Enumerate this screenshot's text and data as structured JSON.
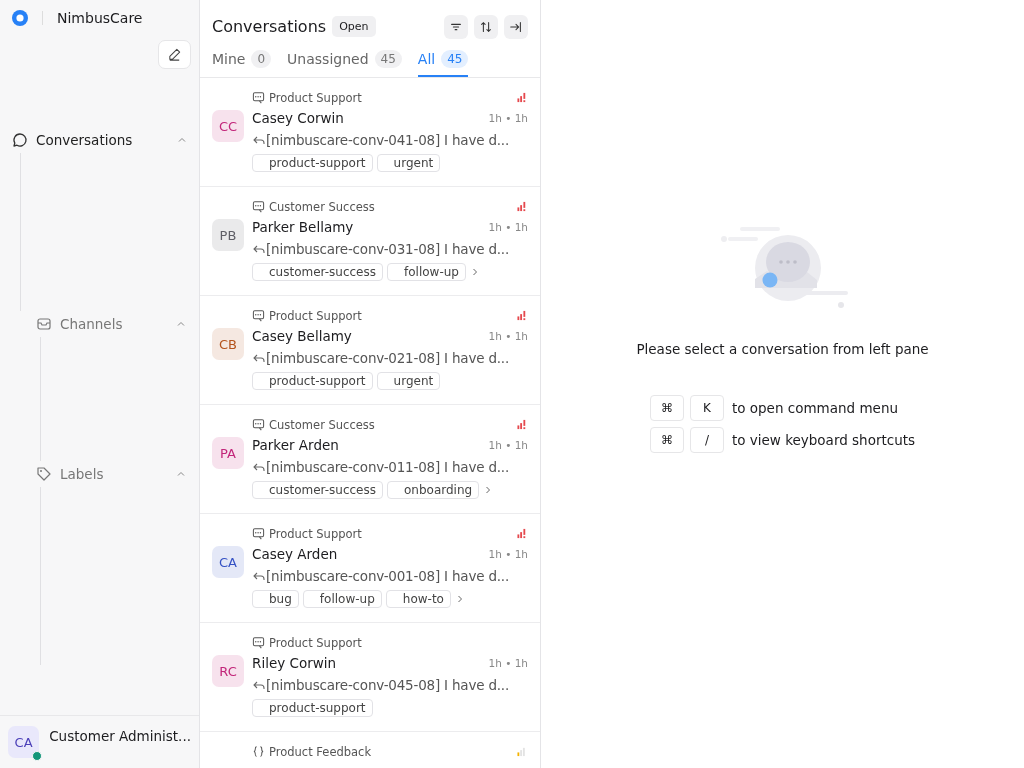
{
  "sidebar": {
    "brand": "NimbusCare",
    "sections": [
      {
        "label": "Conversations",
        "expanded": true,
        "kind": "top"
      },
      {
        "label": "Channels",
        "expanded": true,
        "kind": "nested"
      },
      {
        "label": "Labels",
        "expanded": true,
        "kind": "nested"
      }
    ],
    "user": {
      "initials": "CA",
      "name": "Customer Administ...",
      "online": true
    }
  },
  "list": {
    "title": "Conversations",
    "status": "Open",
    "tabs": [
      {
        "label": "Mine",
        "count": "0",
        "selected": false
      },
      {
        "label": "Unassigned",
        "count": "45",
        "selected": false
      },
      {
        "label": "All",
        "count": "45",
        "selected": true
      }
    ],
    "conversations": [
      {
        "inbox": {
          "name": "Product Support",
          "kind": "web"
        },
        "priority": {
          "kind": "urgent"
        },
        "initials": "CC",
        "color": "#c2267a",
        "name": "Casey Corwin",
        "time": "1h • 1h",
        "preview": "[nimbuscare-conv-041-08] I have d...",
        "tags": [
          "product-support",
          "urgent"
        ],
        "more_tags": false
      },
      {
        "inbox": {
          "name": "Customer Success",
          "kind": "web"
        },
        "priority": {
          "kind": "urgent"
        },
        "initials": "PB",
        "color": "#5f5f66",
        "name": "Parker Bellamy",
        "time": "1h • 1h",
        "preview": "[nimbuscare-conv-031-08] I have d...",
        "tags": [
          "customer-success",
          "follow-up"
        ],
        "more_tags": true
      },
      {
        "inbox": {
          "name": "Product Support",
          "kind": "web"
        },
        "priority": {
          "kind": "urgent"
        },
        "initials": "CB",
        "color": "#b4531c",
        "name": "Casey Bellamy",
        "time": "1h • 1h",
        "preview": "[nimbuscare-conv-021-08] I have d...",
        "tags": [
          "product-support",
          "urgent"
        ],
        "more_tags": false
      },
      {
        "inbox": {
          "name": "Customer Success",
          "kind": "web"
        },
        "priority": {
          "kind": "urgent"
        },
        "initials": "PA",
        "color": "#c2267a",
        "name": "Parker Arden",
        "time": "1h • 1h",
        "preview": "[nimbuscare-conv-011-08] I have d...",
        "tags": [
          "customer-success",
          "onboarding"
        ],
        "more_tags": true
      },
      {
        "inbox": {
          "name": "Product Support",
          "kind": "web"
        },
        "priority": {
          "kind": "urgent"
        },
        "initials": "CA",
        "color": "#3451c4",
        "name": "Casey Arden",
        "time": "1h • 1h",
        "preview": "[nimbuscare-conv-001-08] I have d...",
        "tags": [
          "bug",
          "follow-up",
          "how-to"
        ],
        "more_tags": true
      },
      {
        "inbox": {
          "name": "Product Support",
          "kind": "web"
        },
        "priority": {
          "kind": "none"
        },
        "initials": "RC",
        "color": "#c2267a",
        "name": "Riley Corwin",
        "time": "1h • 1h",
        "preview": "[nimbuscare-conv-045-08] I have d...",
        "tags": [
          "product-support"
        ],
        "more_tags": false
      },
      {
        "inbox": {
          "name": "Product Feedback",
          "kind": "api"
        },
        "priority": {
          "kind": "low"
        }
      }
    ]
  },
  "empty_state": {
    "message": "Please select a conversation from left pane",
    "shortcuts": [
      {
        "keys": [
          "⌘",
          "K"
        ],
        "text": "to open command menu"
      },
      {
        "keys": [
          "⌘",
          "/"
        ],
        "text": "to view keyboard shortcuts"
      }
    ]
  }
}
